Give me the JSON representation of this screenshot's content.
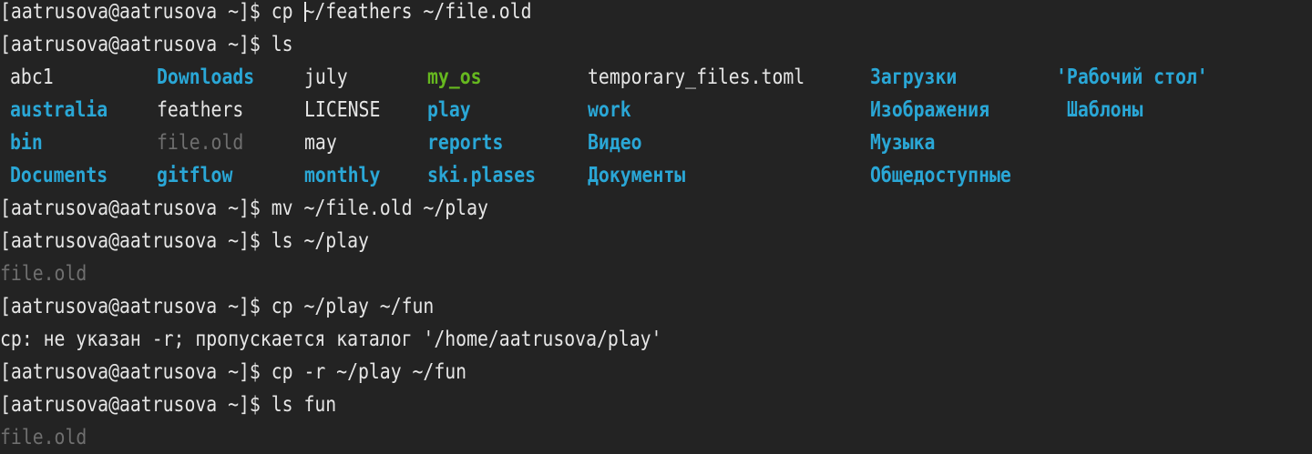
{
  "terminal": {
    "lines": [
      "[aatrusova@aatrusova ~]$ cp ~/feathers ~/file.old",
      "[aatrusova@aatrusova ~]$ ls",
      "[aatrusova@aatrusova ~]$ mv ~/file.old ~/play",
      "[aatrusova@aatrusova ~]$ ls ~/play",
      "file.old",
      "[aatrusova@aatrusova ~]$ cp ~/play ~/fun",
      "cp: не указан -r; пропускается каталог '/home/aatrusova/play'",
      "[aatrusova@aatrusova ~]$ cp -r ~/play ~/fun",
      "[aatrusova@aatrusova ~]$ ls fun",
      "file.old"
    ],
    "ls_output": [
      [
        {
          "name": "abc1",
          "type": "file"
        },
        {
          "name": "Downloads",
          "type": "dir"
        },
        {
          "name": "july",
          "type": "file"
        },
        {
          "name": "my_os",
          "type": "exec"
        },
        {
          "name": "temporary_files.toml",
          "type": "file"
        },
        {
          "name": "Загрузки",
          "type": "dir"
        },
        {
          "name": "'Рабочий стол'",
          "type": "dir"
        }
      ],
      [
        {
          "name": "australia",
          "type": "dir"
        },
        {
          "name": "feathers",
          "type": "file"
        },
        {
          "name": "LICENSE",
          "type": "file"
        },
        {
          "name": "play",
          "type": "dir"
        },
        {
          "name": "work",
          "type": "dir"
        },
        {
          "name": "Изображения",
          "type": "dir"
        },
        {
          "name": "Шаблоны",
          "type": "dir"
        }
      ],
      [
        {
          "name": "bin",
          "type": "dir"
        },
        {
          "name": "file.old",
          "type": "dim"
        },
        {
          "name": "may",
          "type": "file"
        },
        {
          "name": "reports",
          "type": "dir"
        },
        {
          "name": "Видео",
          "type": "dir"
        },
        {
          "name": "Музыка",
          "type": "dir"
        }
      ],
      [
        {
          "name": "Documents",
          "type": "dir"
        },
        {
          "name": "gitflow",
          "type": "dir"
        },
        {
          "name": "monthly",
          "type": "dir"
        },
        {
          "name": "ski.plases",
          "type": "dir"
        },
        {
          "name": "Документы",
          "type": "dir"
        },
        {
          "name": "Общедоступные",
          "type": "dir"
        }
      ]
    ]
  },
  "colors": {
    "background": "#232323",
    "text": "#e6e6e6",
    "directory": "#2aa7d6",
    "executable": "#66b81f",
    "dim": "#6f6f6f"
  }
}
